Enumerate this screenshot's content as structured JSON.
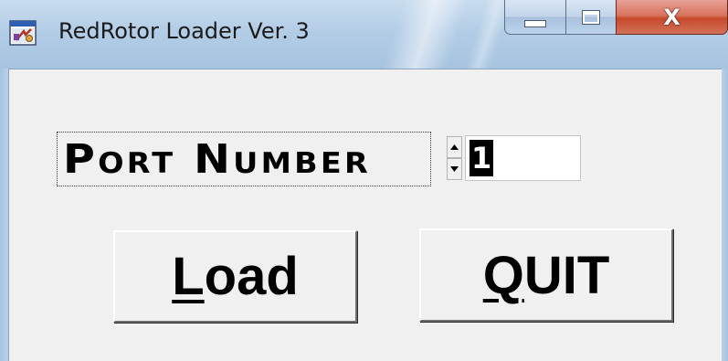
{
  "window": {
    "title": "RedRotor Loader Ver. 3",
    "app_icon": "app-icon",
    "caption_buttons": {
      "minimize_icon": "minimize-icon",
      "maximize_icon": "maximize-icon",
      "close_glyph": "X"
    }
  },
  "form": {
    "port_label": "Port Number",
    "port_value": "1",
    "spinner": {
      "up_icon": "spin-up-icon",
      "down_icon": "spin-down-icon"
    }
  },
  "buttons": {
    "load": {
      "mnemonic": "L",
      "rest": "oad"
    },
    "quit": {
      "mnemonic": "Q",
      "rest": "UIT"
    }
  },
  "colors": {
    "title_bar": "#b3cde6",
    "close_button": "#c7492c",
    "client_background": "#f0f0f0",
    "selection": "#000000"
  }
}
